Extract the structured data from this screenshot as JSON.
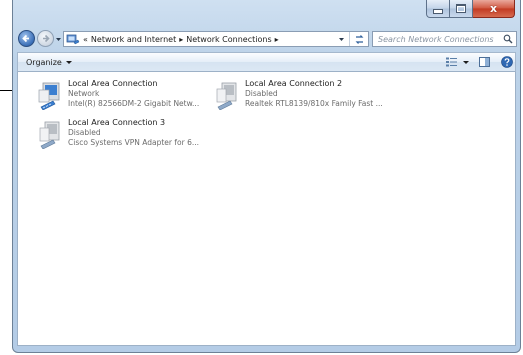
{
  "window": {
    "caption_buttons": {
      "minimize_icon": "minimize-icon",
      "maximize_icon": "maximize-icon",
      "close_icon": "close-icon",
      "close_glyph": "x"
    }
  },
  "address_bar": {
    "prefix": "«",
    "breadcrumbs": [
      {
        "label": "Network and Internet"
      },
      {
        "label": "Network Connections"
      }
    ],
    "separator": "▸"
  },
  "search": {
    "placeholder": "Search Network Connections"
  },
  "toolbar": {
    "organize_label": "Organize"
  },
  "connections": [
    {
      "name": "Local Area Connection",
      "status": "Network",
      "device": "Intel(R) 82566DM-2 Gigabit Netw...",
      "icon": "network-adapter-icon"
    },
    {
      "name": "Local Area Connection 2",
      "status": "Disabled",
      "device": "Realtek RTL8139/810x Family Fast ...",
      "icon": "network-adapter-disabled-icon"
    },
    {
      "name": "Local Area Connection 3",
      "status": "Disabled",
      "device": "Cisco Systems VPN Adapter for 6...",
      "icon": "network-adapter-disabled-icon"
    }
  ],
  "colors": {
    "chrome_blue": "#bcd2e8",
    "close_red": "#c23a22",
    "adapter_blue": "#3c7fd0"
  }
}
